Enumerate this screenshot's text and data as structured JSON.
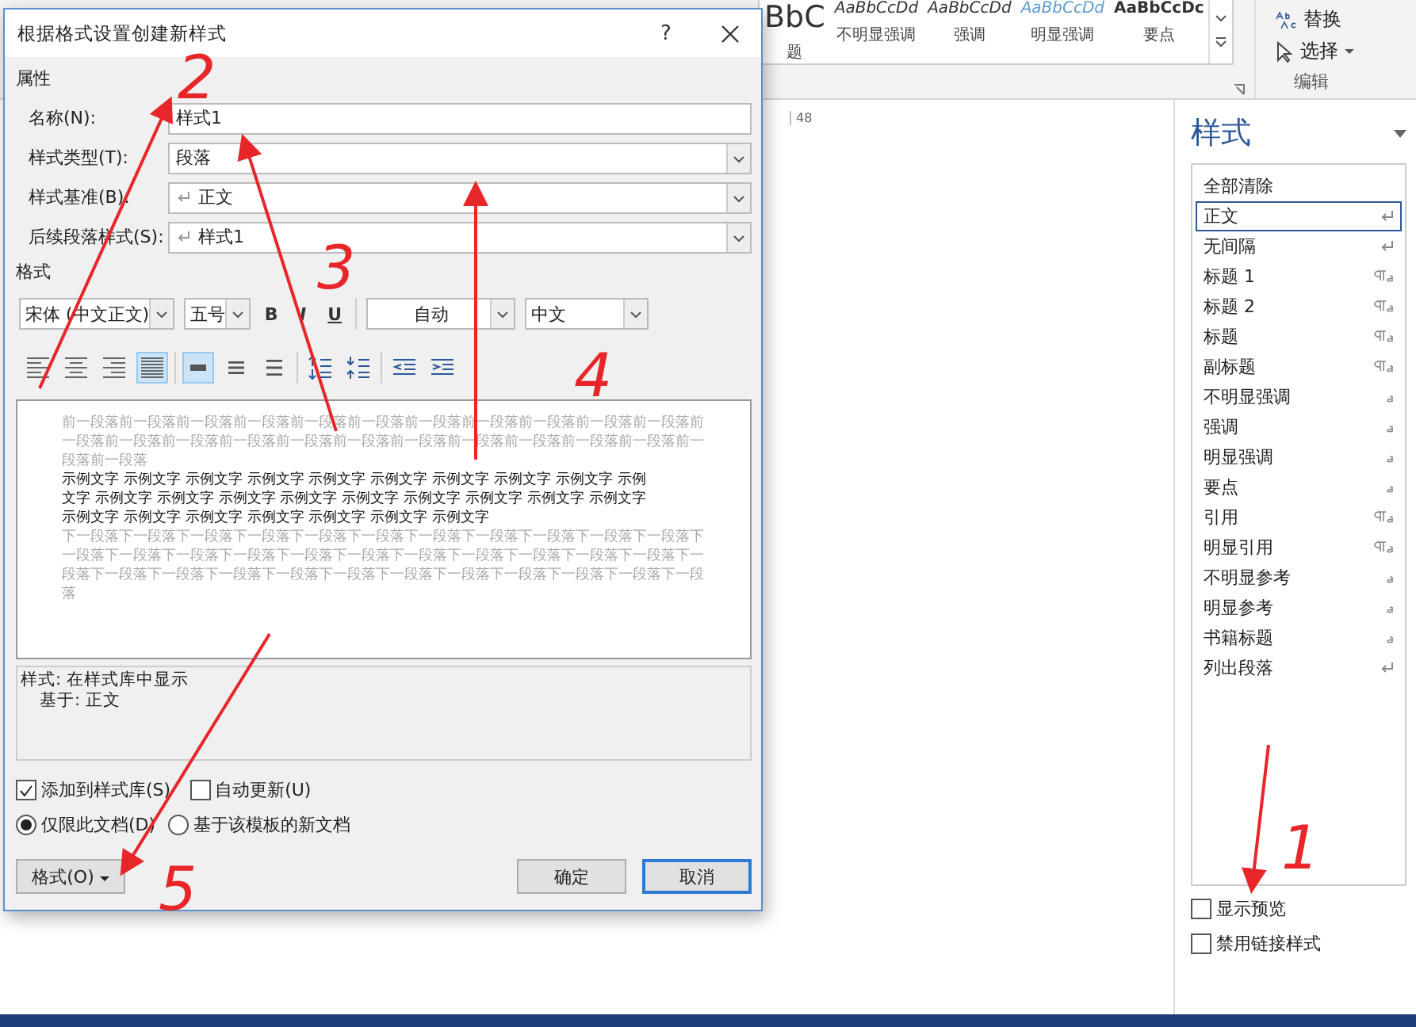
{
  "ribbon": {
    "gallery": [
      {
        "sample": "BbC",
        "label": "题",
        "kind": "title"
      },
      {
        "sample": "AaBbCcDd",
        "label": "不明显强调",
        "kind": "subtle"
      },
      {
        "sample": "AaBbCcDd",
        "label": "强调",
        "kind": "emphasis"
      },
      {
        "sample": "AaBbCcDd",
        "label": "明显强调",
        "kind": "intense"
      },
      {
        "sample": "AaBbCcDc",
        "label": "要点",
        "kind": "strong"
      }
    ],
    "editing": {
      "replace": "替换",
      "select": "选择",
      "group_label": "编辑"
    }
  },
  "ruler": {
    "mark": "48"
  },
  "dialog": {
    "title": "根据格式设置创建新样式",
    "help": "?",
    "properties": {
      "heading": "属性",
      "fields": [
        {
          "label": "名称(N):",
          "value": "样式1",
          "kind": "text"
        },
        {
          "label": "样式类型(T):",
          "value": "段落",
          "kind": "dropdown"
        },
        {
          "label": "样式基准(B):",
          "value": "正文",
          "kind": "style-dropdown"
        },
        {
          "label": "后续段落样式(S):",
          "value": "样式1",
          "kind": "style-dropdown"
        }
      ]
    },
    "format": {
      "heading": "格式",
      "font": "宋体 (中文正文)",
      "size": "五号",
      "bold": "B",
      "italic": "I",
      "underline": "U",
      "text_color": "自动",
      "language": "中文",
      "alignment": [
        {
          "kind": "left",
          "selected": false
        },
        {
          "kind": "center",
          "selected": false
        },
        {
          "kind": "right",
          "selected": false
        },
        {
          "kind": "justify",
          "selected": true
        }
      ],
      "spacing": [
        {
          "kind": "single",
          "selected": true
        },
        {
          "kind": "one-half",
          "selected": false
        },
        {
          "kind": "double",
          "selected": false
        }
      ]
    },
    "preview": {
      "previous": "前一段落前一段落前一段落前一段落前一段落前一段落前一段落前一段落前一段落前一段落前一段落前一段落前一段落前一段落前一段落前一段落前一段落前一段落前一段落前一段落前一段落前一段落前一段落前一段落",
      "sample_lines": [
        "示例文字 示例文字 示例文字 示例文字 示例文字 示例文字 示例文字 示例文字 示例文字 示例",
        "文字 示例文字 示例文字 示例文字 示例文字 示例文字 示例文字 示例文字 示例文字 示例文字",
        "示例文字 示例文字 示例文字 示例文字 示例文字 示例文字 示例文字"
      ],
      "next": "下一段落下一段落下一段落下一段落下一段落下一段落下一段落下一段落下一段落下一段落下一段落下一段落下一段落下一段落下一段落下一段落下一段落下一段落下一段落下一段落下一段落下一段落下一段落下一段落下一段落下一段落下一段落下一段落下一段落下一段落下一段落下一段落下一段落下一段落"
    },
    "description": [
      "样式: 在样式库中显示",
      "基于: 正文"
    ],
    "checkboxes": [
      {
        "label": "添加到样式库(S)",
        "checked": true
      },
      {
        "label": "自动更新(U)",
        "checked": false
      }
    ],
    "radios": [
      {
        "label": "仅限此文档(D)",
        "selected": true
      },
      {
        "label": "基于该模板的新文档",
        "selected": false
      }
    ],
    "buttons": {
      "format": "格式(O)",
      "ok": "确定",
      "cancel": "取消"
    }
  },
  "styles_pane": {
    "title": "样式",
    "items": [
      {
        "name": "全部清除",
        "kind": "clear",
        "selected": false
      },
      {
        "name": "正文",
        "kind": "paragraph",
        "selected": true
      },
      {
        "name": "无间隔",
        "kind": "paragraph",
        "selected": false
      },
      {
        "name": "标题 1",
        "kind": "linked",
        "selected": false
      },
      {
        "name": "标题 2",
        "kind": "linked",
        "selected": false
      },
      {
        "name": "标题",
        "kind": "linked",
        "selected": false
      },
      {
        "name": "副标题",
        "kind": "linked",
        "selected": false
      },
      {
        "name": "不明显强调",
        "kind": "character",
        "selected": false
      },
      {
        "name": "强调",
        "kind": "character",
        "selected": false
      },
      {
        "name": "明显强调",
        "kind": "character",
        "selected": false
      },
      {
        "name": "要点",
        "kind": "character",
        "selected": false
      },
      {
        "name": "引用",
        "kind": "linked",
        "selected": false
      },
      {
        "name": "明显引用",
        "kind": "linked",
        "selected": false
      },
      {
        "name": "不明显参考",
        "kind": "character",
        "selected": false
      },
      {
        "name": "明显参考",
        "kind": "character",
        "selected": false
      },
      {
        "name": "书籍标题",
        "kind": "character",
        "selected": false
      },
      {
        "name": "列出段落",
        "kind": "paragraph",
        "selected": false
      }
    ],
    "options": [
      {
        "label": "显示预览",
        "checked": false
      },
      {
        "label": "禁用链接样式",
        "checked": false
      }
    ]
  },
  "annotations": [
    {
      "number": "2"
    },
    {
      "number": "3"
    },
    {
      "number": "4"
    },
    {
      "number": "5"
    },
    {
      "number": "1"
    }
  ]
}
